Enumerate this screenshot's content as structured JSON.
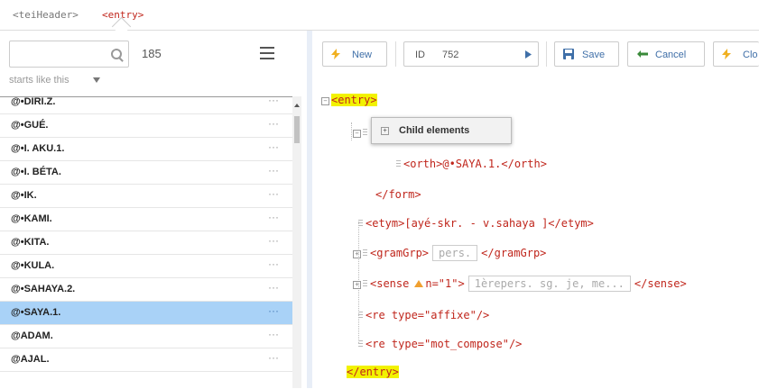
{
  "breadcrumb": [
    "<teiHeader>",
    "<entry>"
  ],
  "left": {
    "count": "185",
    "filter_label": "starts like this",
    "rows": [
      {
        "label": "@•DIRI.Z.",
        "dots": "···"
      },
      {
        "label": "@•GUÉ.",
        "dots": "···"
      },
      {
        "label": "@•I. AKU.1.",
        "dots": "···"
      },
      {
        "label": "@•I. BÉTA.",
        "dots": "···"
      },
      {
        "label": "@•IK.",
        "dots": "···"
      },
      {
        "label": "@•KAMI.",
        "dots": "···"
      },
      {
        "label": "@•KITA.",
        "dots": "···"
      },
      {
        "label": "@•KULA.",
        "dots": "···"
      },
      {
        "label": "@•SAHAYA.2.",
        "dots": "···"
      },
      {
        "label": "@•SAYA.1.",
        "dots": "···"
      },
      {
        "label": "@ADAM.",
        "dots": "···"
      },
      {
        "label": "@AJAL.",
        "dots": "···"
      }
    ],
    "selected_index": 9
  },
  "toolbar": {
    "new_label": "New",
    "id_label": "ID",
    "id_value": "752",
    "save_label": "Save",
    "cancel_label": "Cancel",
    "clo_label": "Clo"
  },
  "tree": {
    "entry_open": "<entry>",
    "popup_label": "Child elements",
    "orth": "<orth>@•SAYA.1.</orth>",
    "form_close": "</form>",
    "etym": "<etym>[ayé-skr. - v.sahaya ]</etym>",
    "gramgrp_open": "<gramGrp>",
    "gramgrp_value": "pers.",
    "gramgrp_close": "</gramGrp>",
    "sense_open": "<sense",
    "sense_attr": "n=\"1\">",
    "sense_value": "1èrepers. sg. je, me...",
    "sense_close": "</sense>",
    "re1": "<re type=\"affixe\"/>",
    "re2": "<re type=\"mot_compose\"/>",
    "entry_close": "</entry>"
  },
  "colors": {
    "selected_row": "#a9d2f7",
    "tag_red": "#c0261c",
    "highlight": "#f2f200",
    "button_blue": "#3f6fa8"
  }
}
